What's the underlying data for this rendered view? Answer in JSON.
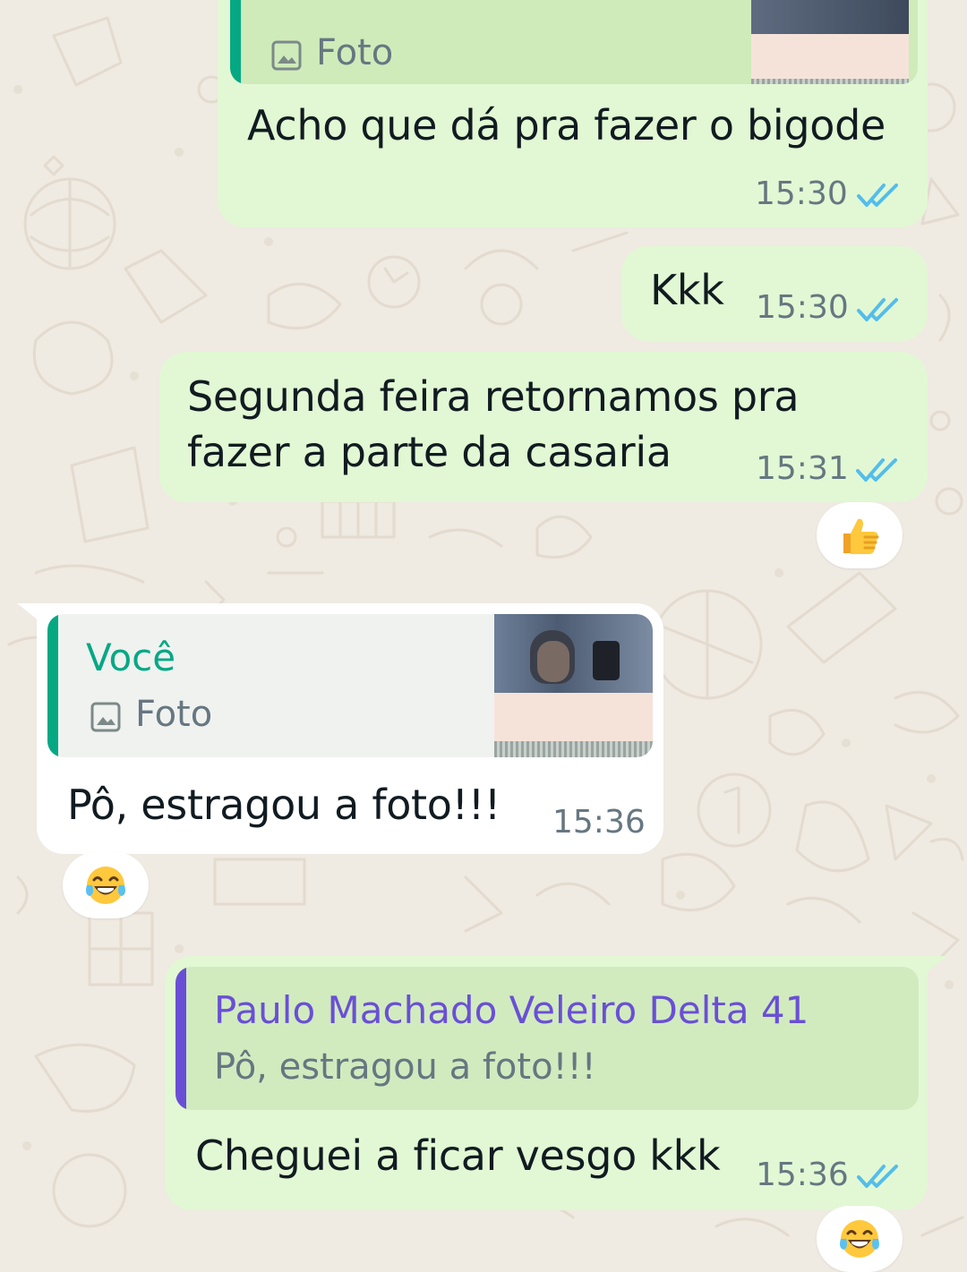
{
  "colors": {
    "wallpaper": "#efeae2",
    "outgoing_bubble": "#e2f8d4",
    "incoming_bubble": "#ffffff",
    "read_ticks": "#53bdeb",
    "you_accent": "#06a884",
    "contact_accent": "#6a4fd6"
  },
  "messages": [
    {
      "direction": "outgoing",
      "quote": {
        "type_label": "Foto",
        "icon": "photo-icon"
      },
      "text": "Acho que dá pra fazer o bigode",
      "time": "15:30",
      "status": "read"
    },
    {
      "direction": "outgoing",
      "text": "Kkk",
      "time": "15:30",
      "status": "read"
    },
    {
      "direction": "outgoing",
      "text_lines": [
        "Segunda feira retornamos pra",
        "fazer a parte da casaria"
      ],
      "time": "15:31",
      "status": "read",
      "reaction": "thumbs-up-emoji"
    },
    {
      "direction": "incoming",
      "quote": {
        "author": "Você",
        "type_label": "Foto",
        "icon": "photo-icon"
      },
      "text": "Pô, estragou a foto!!!",
      "time": "15:36",
      "reaction": "tears-of-joy-emoji"
    },
    {
      "direction": "outgoing",
      "quote": {
        "author": "Paulo Machado Veleiro Delta 41",
        "text": "Pô, estragou a foto!!!"
      },
      "text": "Cheguei a ficar vesgo kkk",
      "time": "15:36",
      "status": "read",
      "reaction": "tears-of-joy-emoji"
    }
  ]
}
